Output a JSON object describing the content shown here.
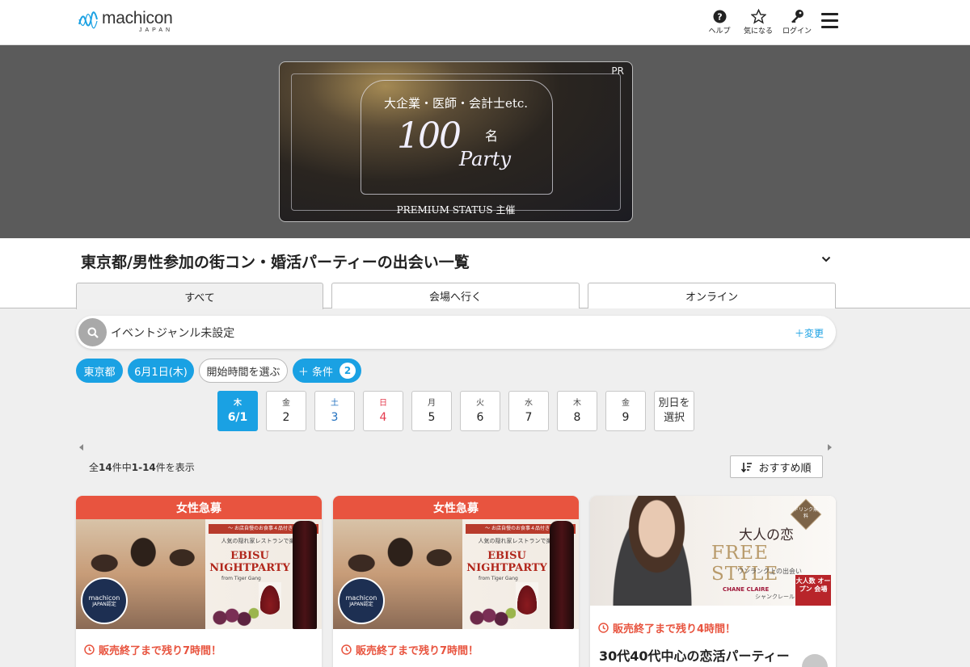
{
  "header": {
    "logo_text": "machicon",
    "logo_sub": "JAPAN",
    "nav": [
      {
        "label": "ヘルプ",
        "icon": "help-icon"
      },
      {
        "label": "気になる",
        "icon": "star-icon"
      },
      {
        "label": "ログイン",
        "icon": "key-icon"
      }
    ],
    "menu_icon": "hamburger-menu-icon"
  },
  "banner": {
    "pr": "PR",
    "top_text": "大企業・医師・会計士etc.",
    "big_number": "100",
    "unit": "名",
    "party": "Party",
    "footer": "PREMIUM STATUS 主催"
  },
  "page": {
    "title": "東京都/男性参加の街コン・婚活パーティーの出会い一覧"
  },
  "tabs": [
    {
      "label": "すべて",
      "active": true
    },
    {
      "label": "会場へ行く",
      "active": false
    },
    {
      "label": "オンライン",
      "active": false
    }
  ],
  "search": {
    "value": "イベントジャンル未設定",
    "change_label": "＋変更"
  },
  "chips": {
    "area": "東京都",
    "date": "6月1日(木)",
    "time": "開始時間を選ぶ",
    "conditions": "＋ 条件",
    "conditions_count": "2"
  },
  "dates": [
    {
      "dow": "木",
      "day": "6/1"
    },
    {
      "dow": "金",
      "day": "2"
    },
    {
      "dow": "土",
      "day": "3"
    },
    {
      "dow": "日",
      "day": "4"
    },
    {
      "dow": "月",
      "day": "5"
    },
    {
      "dow": "火",
      "day": "6"
    },
    {
      "dow": "水",
      "day": "7"
    },
    {
      "dow": "木",
      "day": "8"
    },
    {
      "dow": "金",
      "day": "9"
    }
  ],
  "other_date": {
    "line1": "別日を",
    "line2": "選択"
  },
  "results": {
    "total_prefix": "全",
    "total": "14",
    "mid": "件中",
    "range": "1-14",
    "suffix": "件を表示"
  },
  "sort_label": "おすすめ順",
  "cards": [
    {
      "header": "女性急募",
      "img_ribbon": "～ お店自慢のお食事４品付き ～",
      "img_sub": "人気の隠れ家レストランで楽しむ",
      "img_title_1": "EBISU",
      "img_title_2": "NIGHTPARTY",
      "img_from": "from  Tiger Gang",
      "seal_1": "machicon",
      "seal_2": "JAPAN認定",
      "time": "販売終了まで残り7時間！"
    },
    {
      "header": "女性急募",
      "img_ribbon": "～ お店自慢のお食事４品付き ～",
      "img_sub": "人気の隠れ家レストランで楽しむ",
      "img_title_1": "EBISU",
      "img_title_2": "NIGHTPARTY",
      "img_from": "from  Tiger Gang",
      "seal_1": "machicon",
      "seal_2": "JAPAN認定",
      "time": "販売終了まで残り7時間！"
    },
    {
      "img_drink": "ドリンク無料",
      "img_t1": "大人の恋",
      "img_t2": "FREE STYLE",
      "img_t3": "ワンランク上の出会い",
      "img_logo": "CHANE CLAIRE",
      "img_logo_sub": "シャンクレール",
      "img_red": "大人数 オープン 会場",
      "time": "販売終了まで残り4時間！",
      "title": "30代40代中心の恋活パーティー"
    }
  ]
}
